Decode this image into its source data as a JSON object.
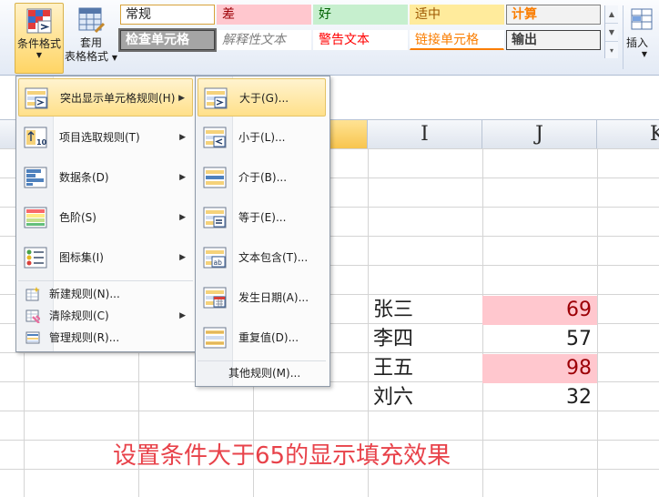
{
  "ribbon": {
    "conditional_format": {
      "label": "条件格式"
    },
    "table_format": {
      "label_line1": "套用",
      "label_line2": "表格格式"
    },
    "insert": {
      "label": "插入"
    },
    "cell_styles": [
      {
        "label": "常规",
        "bg": "#ffffff",
        "color": "#1e1e1e",
        "border": "#d7a23a"
      },
      {
        "label": "差",
        "bg": "#ffc7ce",
        "color": "#9c0006",
        "border": "#ffc7ce"
      },
      {
        "label": "好",
        "bg": "#c6efce",
        "color": "#006100",
        "border": "#c6efce"
      },
      {
        "label": "适中",
        "bg": "#ffeb9c",
        "color": "#9c5700",
        "border": "#ffeb9c"
      },
      {
        "label": "计算",
        "bg": "#f2f2f2",
        "color": "#fa7d00",
        "border": "#7f7f7f"
      },
      {
        "label": "检查单元格",
        "bg": "#a5a5a5",
        "color": "#ffffff",
        "border": "#3f3f3f"
      },
      {
        "label": "解释性文本",
        "bg": "#ffffff",
        "color": "#7f7f7f",
        "border": "#ffffff"
      },
      {
        "label": "警告文本",
        "bg": "#ffffff",
        "color": "#ff0000",
        "border": "#ffffff"
      },
      {
        "label": "链接单元格",
        "bg": "#ffffff",
        "color": "#fa7d00",
        "border": "#ffffff"
      },
      {
        "label": "输出",
        "bg": "#f2f2f2",
        "color": "#3f3f3f",
        "border": "#3f3f3f"
      }
    ]
  },
  "columns": [
    {
      "label": "I"
    },
    {
      "label": "J"
    },
    {
      "label": "K"
    }
  ],
  "sheet_rows": [
    {
      "name": "张三",
      "value": "69",
      "highlight": true
    },
    {
      "name": "李四",
      "value": "57",
      "highlight": false
    },
    {
      "name": "王五",
      "value": "98",
      "highlight": true
    },
    {
      "name": "刘六",
      "value": "32",
      "highlight": false
    }
  ],
  "highlight_color": "#ffc7ce",
  "note": "设置条件大于65的显示填充效果",
  "note_color": "#e8424a",
  "main_menu": {
    "items": [
      {
        "label": "突出显示单元格规则(H)",
        "icon": "highlight-rules-icon",
        "has_submenu": true,
        "active": true
      },
      {
        "label": "项目选取规则(T)",
        "icon": "top-bottom-rules-icon",
        "has_submenu": true
      },
      {
        "label": "数据条(D)",
        "icon": "data-bars-icon",
        "has_submenu": true
      },
      {
        "label": "色阶(S)",
        "icon": "color-scales-icon",
        "has_submenu": true
      },
      {
        "label": "图标集(I)",
        "icon": "icon-sets-icon",
        "has_submenu": true
      }
    ],
    "small_items": [
      {
        "label": "新建规则(N)...",
        "icon": "new-rule-icon",
        "has_submenu": false
      },
      {
        "label": "清除规则(C)",
        "icon": "clear-rules-icon",
        "has_submenu": true
      },
      {
        "label": "管理规则(R)...",
        "icon": "manage-rules-icon",
        "has_submenu": false
      }
    ]
  },
  "sub_menu": {
    "items": [
      {
        "label": "大于(G)...",
        "icon": "greater-than-icon",
        "active": true
      },
      {
        "label": "小于(L)...",
        "icon": "less-than-icon"
      },
      {
        "label": "介于(B)...",
        "icon": "between-icon"
      },
      {
        "label": "等于(E)...",
        "icon": "equal-to-icon"
      },
      {
        "label": "文本包含(T)...",
        "icon": "text-contains-icon"
      },
      {
        "label": "发生日期(A)...",
        "icon": "date-occurring-icon"
      },
      {
        "label": "重复值(D)...",
        "icon": "duplicate-values-icon"
      }
    ],
    "more": {
      "label": "其他规则(M)..."
    }
  }
}
